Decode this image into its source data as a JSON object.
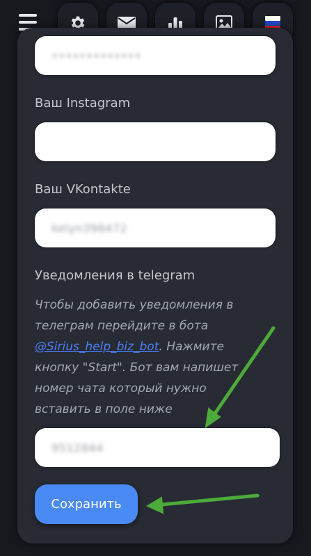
{
  "topbar": {
    "icons": [
      "menu-icon",
      "gear-icon",
      "mail-icon",
      "bar-chart-icon",
      "image-icon",
      "russia-flag-icon"
    ]
  },
  "form": {
    "field1_value": "•••••••••••••",
    "instagram_label": "Ваш Instagram",
    "instagram_value": "",
    "vk_label": "Ваш VKontakte",
    "vk_value": "kelyn398472",
    "telegram_label": "Уведомления в telegram",
    "note_part1": "Чтобы добавить уведомления в телеграм перейдите в бота ",
    "bot_link": "@Sirius_help_biz_bot",
    "note_part2": ". Нажмите кнопку \"Start\". Бот вам напишет номер чата который нужно вставить в поле ниже",
    "chat_value": "9512844",
    "save_label": "Сохранить"
  },
  "colors": {
    "background": "#17191f",
    "card": "#282b34",
    "accent": "#4a8af4",
    "link": "#4a7ff5",
    "arrow": "#4caa3a"
  }
}
